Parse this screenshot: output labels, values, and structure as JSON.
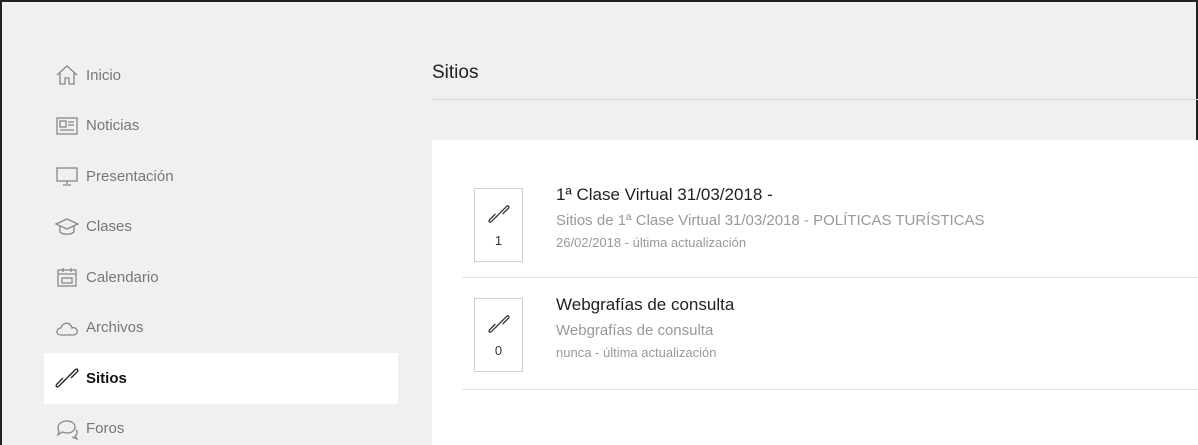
{
  "sidebar": {
    "items": [
      {
        "label": "Inicio",
        "icon": "home-icon"
      },
      {
        "label": "Noticias",
        "icon": "newspaper-icon"
      },
      {
        "label": "Presentación",
        "icon": "monitor-icon"
      },
      {
        "label": "Clases",
        "icon": "graduation-cap-icon"
      },
      {
        "label": "Calendario",
        "icon": "calendar-icon"
      },
      {
        "label": "Archivos",
        "icon": "cloud-icon"
      },
      {
        "label": "Sitios",
        "icon": "link-icon"
      },
      {
        "label": "Foros",
        "icon": "chat-bubbles-icon"
      }
    ],
    "active": "Sitios"
  },
  "header": {
    "title": "Sitios"
  },
  "sites": [
    {
      "title": "1ª Clase Virtual 31/03/2018 -",
      "description": "Sitios de 1ª Clase Virtual 31/03/2018 - POLÍTICAS TURÍSTICAS",
      "updated": "26/02/2018 - última actualización",
      "count": "1",
      "icon": "link-icon"
    },
    {
      "title": "Webgrafías de consulta",
      "description": "Webgrafías de consulta",
      "updated": "nunca - última actualización",
      "count": "0",
      "icon": "link-icon"
    }
  ],
  "colors": {
    "background": "#f0f0f0",
    "panel": "#ffffff",
    "active_item": "#ffffff",
    "muted_text": "#999999"
  }
}
